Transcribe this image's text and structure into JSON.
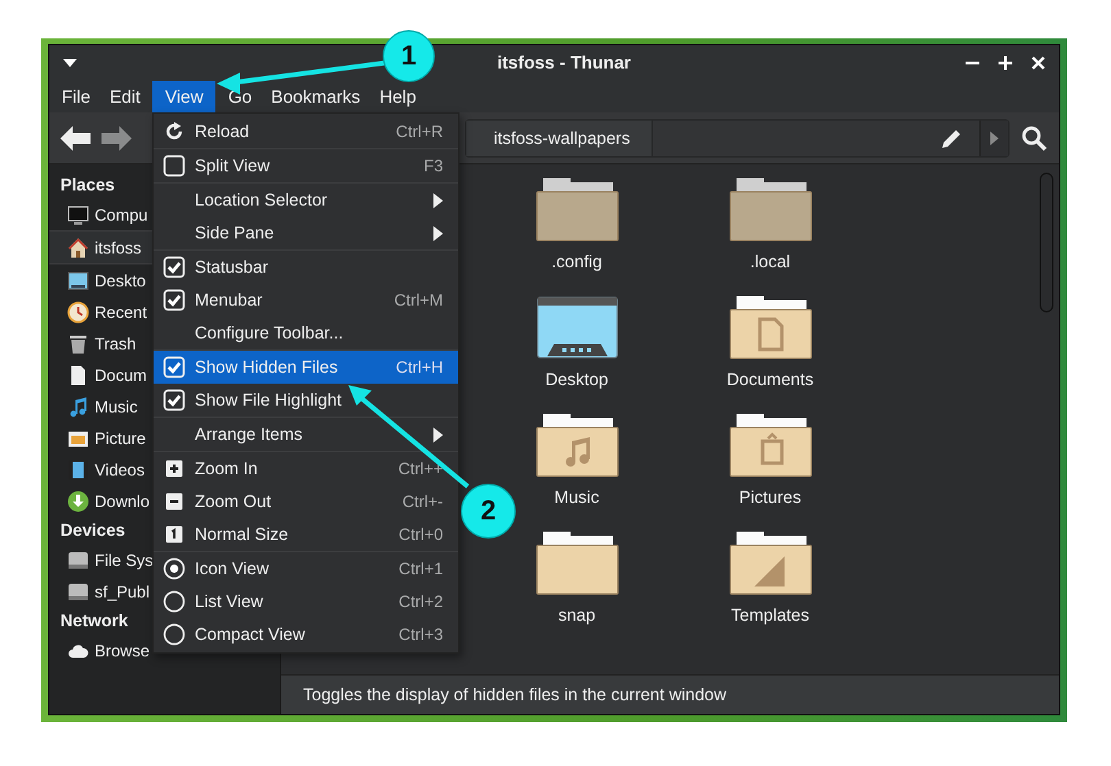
{
  "window": {
    "title": "itsfoss - Thunar"
  },
  "menubar": [
    {
      "label": "File",
      "selected": false
    },
    {
      "label": "Edit",
      "selected": false
    },
    {
      "label": "View",
      "selected": true
    },
    {
      "label": "Go",
      "selected": false
    },
    {
      "label": "Bookmarks",
      "selected": false
    },
    {
      "label": "Help",
      "selected": false
    }
  ],
  "toolbar": {
    "path": "itsfoss-wallpapers"
  },
  "sidebar": [
    {
      "title": "Places",
      "items": [
        {
          "label": "Compu",
          "kind": "computer",
          "selected": false
        },
        {
          "label": "itsfoss",
          "kind": "home",
          "selected": true
        },
        {
          "label": "Deskto",
          "kind": "desktop",
          "selected": false
        },
        {
          "label": "Recent",
          "kind": "recent",
          "selected": false
        },
        {
          "label": "Trash",
          "kind": "trash",
          "selected": false
        },
        {
          "label": "Docum",
          "kind": "document",
          "selected": false
        },
        {
          "label": "Music",
          "kind": "music",
          "selected": false
        },
        {
          "label": "Picture",
          "kind": "pictures",
          "selected": false
        },
        {
          "label": "Videos",
          "kind": "videos",
          "selected": false
        },
        {
          "label": "Downlo",
          "kind": "download",
          "selected": false
        }
      ]
    },
    {
      "title": "Devices",
      "items": [
        {
          "label": "File Sys",
          "kind": "drive",
          "selected": false
        },
        {
          "label": "sf_Publ",
          "kind": "drive",
          "selected": false
        }
      ]
    },
    {
      "title": "Network",
      "items": [
        {
          "label": "Browse",
          "kind": "cloud",
          "selected": false
        }
      ]
    }
  ],
  "files": [
    {
      "name": ".config",
      "kind": "folder",
      "hidden": true
    },
    {
      "name": ".local",
      "kind": "folder",
      "hidden": true
    },
    {
      "name": "Desktop",
      "kind": "desktop",
      "hidden": false
    },
    {
      "name": "Documents",
      "kind": "documents",
      "hidden": false
    },
    {
      "name": "Music",
      "kind": "music",
      "hidden": false
    },
    {
      "name": "Pictures",
      "kind": "pictures",
      "hidden": false
    },
    {
      "name": "snap",
      "kind": "folder",
      "hidden": false
    },
    {
      "name": "Templates",
      "kind": "templates",
      "hidden": false
    }
  ],
  "status_bar": "Toggles the display of hidden files in the current window",
  "view_menu": [
    [
      {
        "label": "Reload",
        "shortcut": "Ctrl+R",
        "kind": "reload",
        "selected": false
      }
    ],
    [
      {
        "label": "Split View",
        "shortcut": "F3",
        "kind": "check",
        "checked": false,
        "selected": false
      }
    ],
    [
      {
        "label": "Location Selector",
        "kind": "submenu",
        "selected": false
      },
      {
        "label": "Side Pane",
        "kind": "submenu",
        "selected": false
      }
    ],
    [
      {
        "label": "Statusbar",
        "kind": "check",
        "checked": true,
        "selected": false
      },
      {
        "label": "Menubar",
        "shortcut": "Ctrl+M",
        "kind": "check",
        "checked": true,
        "selected": false
      },
      {
        "label": "Configure Toolbar...",
        "kind": "plain",
        "selected": false
      }
    ],
    [
      {
        "label": "Show Hidden Files",
        "shortcut": "Ctrl+H",
        "kind": "check",
        "checked": true,
        "selected": true
      },
      {
        "label": "Show File Highlight",
        "kind": "check",
        "checked": true,
        "selected": false
      }
    ],
    [
      {
        "label": "Arrange Items",
        "kind": "submenu",
        "selected": false
      }
    ],
    [
      {
        "label": "Zoom In",
        "shortcut": "Ctrl++",
        "kind": "plus",
        "selected": false
      },
      {
        "label": "Zoom Out",
        "shortcut": "Ctrl+-",
        "kind": "minus",
        "selected": false
      },
      {
        "label": "Normal Size",
        "shortcut": "Ctrl+0",
        "kind": "normal",
        "selected": false
      }
    ],
    [
      {
        "label": "Icon View",
        "shortcut": "Ctrl+1",
        "kind": "radio",
        "checked": true,
        "selected": false
      },
      {
        "label": "List View",
        "shortcut": "Ctrl+2",
        "kind": "radio",
        "checked": false,
        "selected": false
      },
      {
        "label": "Compact View",
        "shortcut": "Ctrl+3",
        "kind": "radio",
        "checked": false,
        "selected": false
      }
    ]
  ],
  "annotations": [
    {
      "label": "1"
    },
    {
      "label": "2"
    }
  ]
}
